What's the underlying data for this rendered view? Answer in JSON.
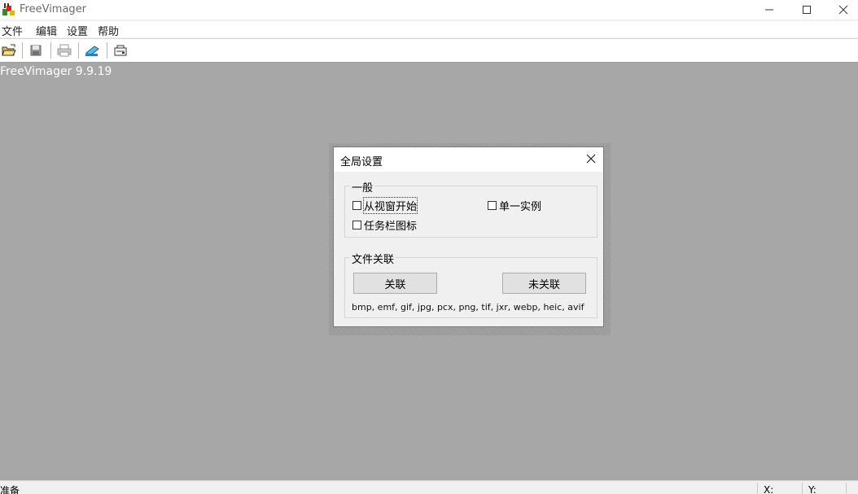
{
  "window": {
    "title": "FreeVimager"
  },
  "menu": {
    "items": [
      "文件",
      "编辑",
      "设置",
      "帮助"
    ]
  },
  "toolbar": {
    "buttons": [
      "open-icon",
      "save-icon",
      "print-icon",
      "scan-icon",
      "capture-icon"
    ]
  },
  "client": {
    "caption": "FreeVimager 9.9.19"
  },
  "status": {
    "text": "准备",
    "x_label": "X:",
    "y_label": "Y:"
  },
  "dialog": {
    "title": "全局设置",
    "general": {
      "legend": "一般",
      "options": {
        "start_from_viewer": "从视窗开始",
        "single_instance": "单一实例",
        "taskbar_icon": "任务栏图标"
      }
    },
    "file_assoc": {
      "legend": "文件关联",
      "associate_label": "关联",
      "unassociate_label": "未关联",
      "extensions": "bmp, emf, gif, jpg, pcx, png, tif, jxr, webp, heic, avif"
    }
  }
}
